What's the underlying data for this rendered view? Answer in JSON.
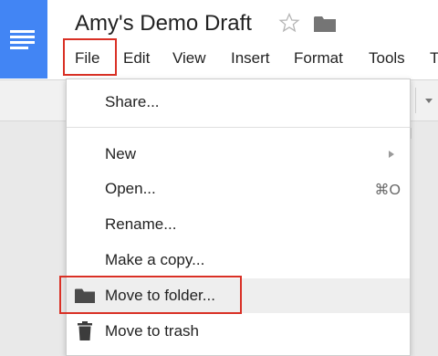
{
  "document": {
    "title": "Amy's Demo Draft"
  },
  "icons": {
    "logo": "docs-logo-icon",
    "star": "star-icon",
    "folder": "folder-icon",
    "trash": "trash-icon"
  },
  "menubar": {
    "items": [
      {
        "label": "File"
      },
      {
        "label": "Edit"
      },
      {
        "label": "View"
      },
      {
        "label": "Insert"
      },
      {
        "label": "Format"
      },
      {
        "label": "Tools"
      },
      {
        "label": "T"
      }
    ]
  },
  "file_menu": {
    "items": [
      {
        "label": "Share...",
        "shortcut": ""
      },
      {
        "label": "New",
        "shortcut": "",
        "has_submenu": true
      },
      {
        "label": "Open...",
        "shortcut": "⌘O"
      },
      {
        "label": "Rename...",
        "shortcut": ""
      },
      {
        "label": "Make a copy...",
        "shortcut": ""
      },
      {
        "label": "Move to folder...",
        "shortcut": "",
        "highlighted": true
      },
      {
        "label": "Move to trash",
        "shortcut": ""
      }
    ]
  },
  "colors": {
    "brand": "#4285f4",
    "highlight_border": "#d93025",
    "hover_background": "#eeeeee"
  }
}
